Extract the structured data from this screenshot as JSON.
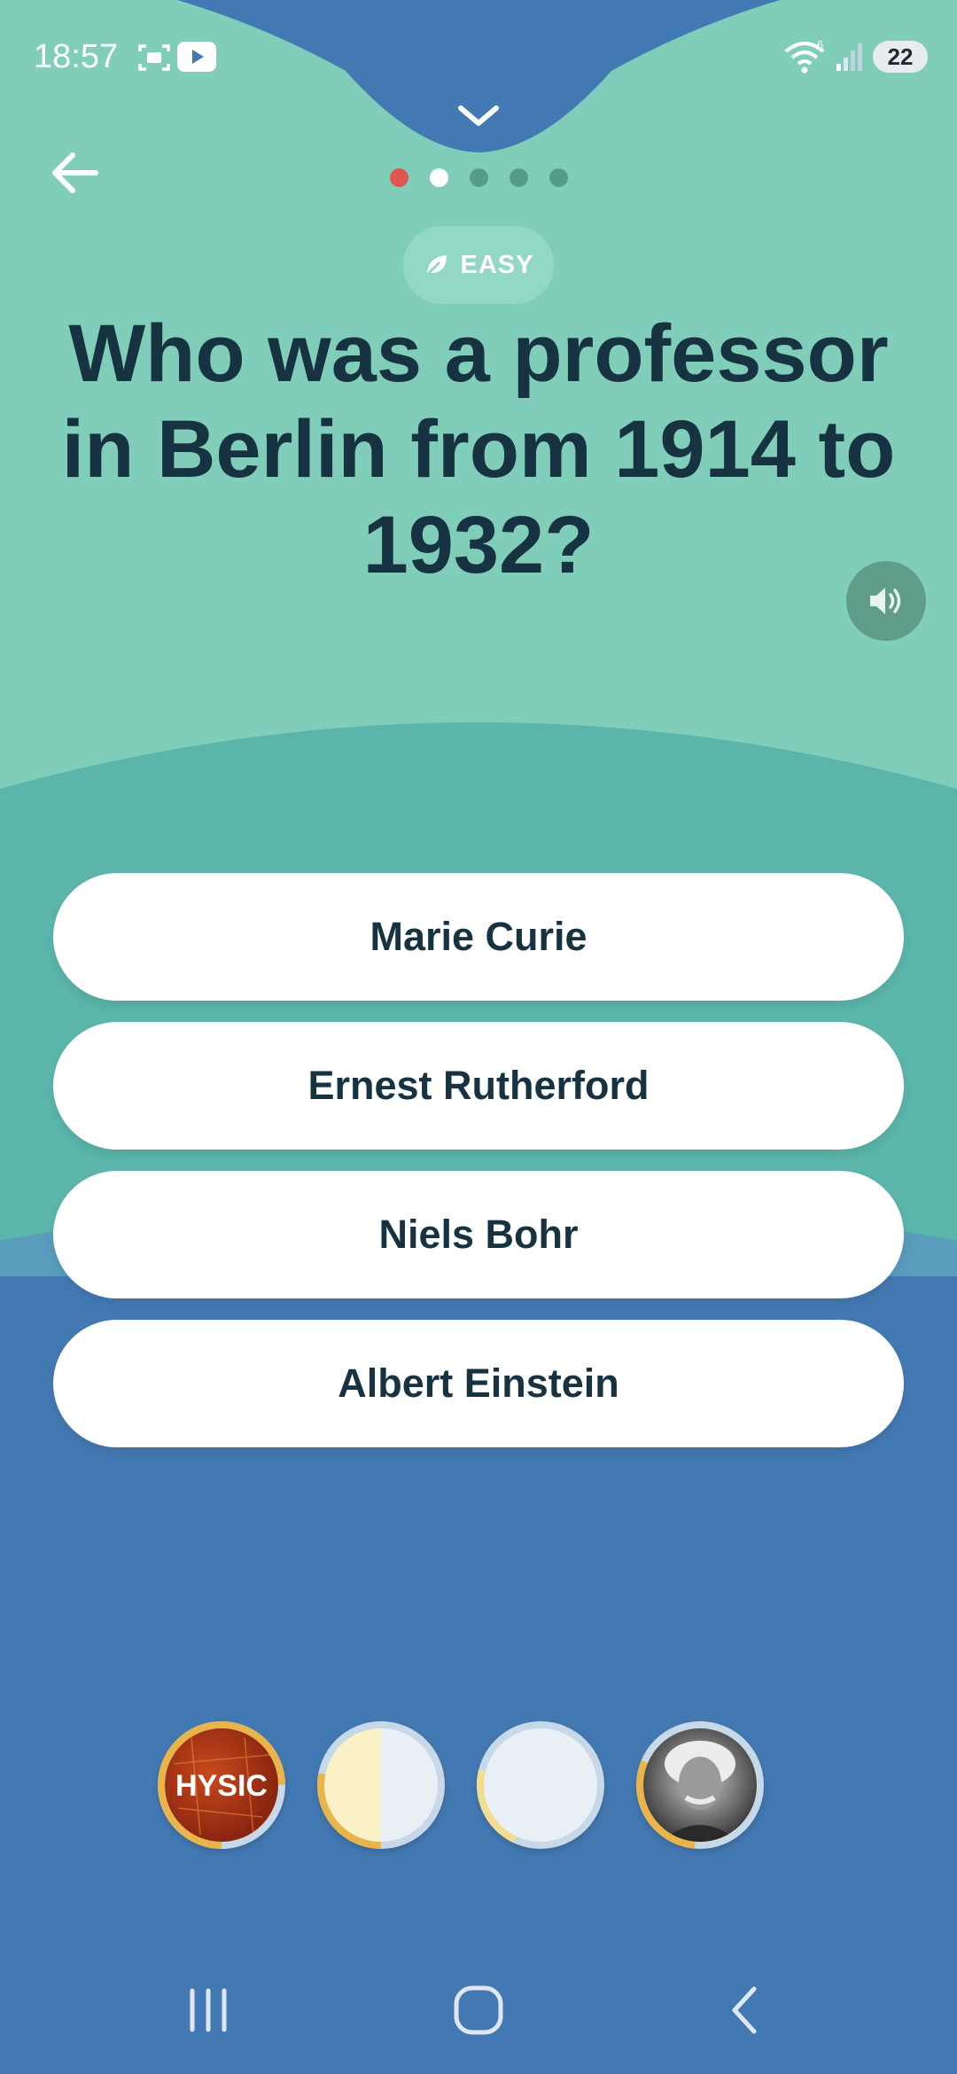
{
  "status_bar": {
    "time": "18:57",
    "battery": "22",
    "icons": [
      "screenshot-icon",
      "youtube-icon",
      "wifi-icon",
      "signal-icon",
      "battery-icon"
    ]
  },
  "header": {
    "back_icon": "arrow-left-icon",
    "collapse_icon": "chevron-down-icon",
    "progress": {
      "total": 5,
      "current_index": 1,
      "answered_wrong_index": 0
    }
  },
  "question": {
    "difficulty": "EASY",
    "difficulty_icon": "leaf-icon",
    "text": "Who was a professor in Berlin from 1914 to 1932?",
    "speaker_icon": "speaker-icon"
  },
  "answers": [
    {
      "label": "Marie Curie"
    },
    {
      "label": "Ernest Rutherford"
    },
    {
      "label": "Niels Bohr"
    },
    {
      "label": "Albert Einstein"
    }
  ],
  "badges": [
    {
      "name": "physics-badge",
      "label": "HYSIC",
      "progress": 0.25
    },
    {
      "name": "badge-2",
      "progress": 0.5
    },
    {
      "name": "badge-3",
      "progress": 0.1
    },
    {
      "name": "einstein-badge",
      "progress": 0.15
    }
  ],
  "colors": {
    "top_band": "#80cdb9",
    "middle_band": "#5bb5ab",
    "lower_band": "#5a9cbc",
    "bottom_band": "#4379b3",
    "text_dark": "#173342",
    "wrong_dot": "#e25450"
  },
  "nav_bar": {
    "icons": [
      "recent-apps-icon",
      "home-icon",
      "back-nav-icon"
    ]
  }
}
